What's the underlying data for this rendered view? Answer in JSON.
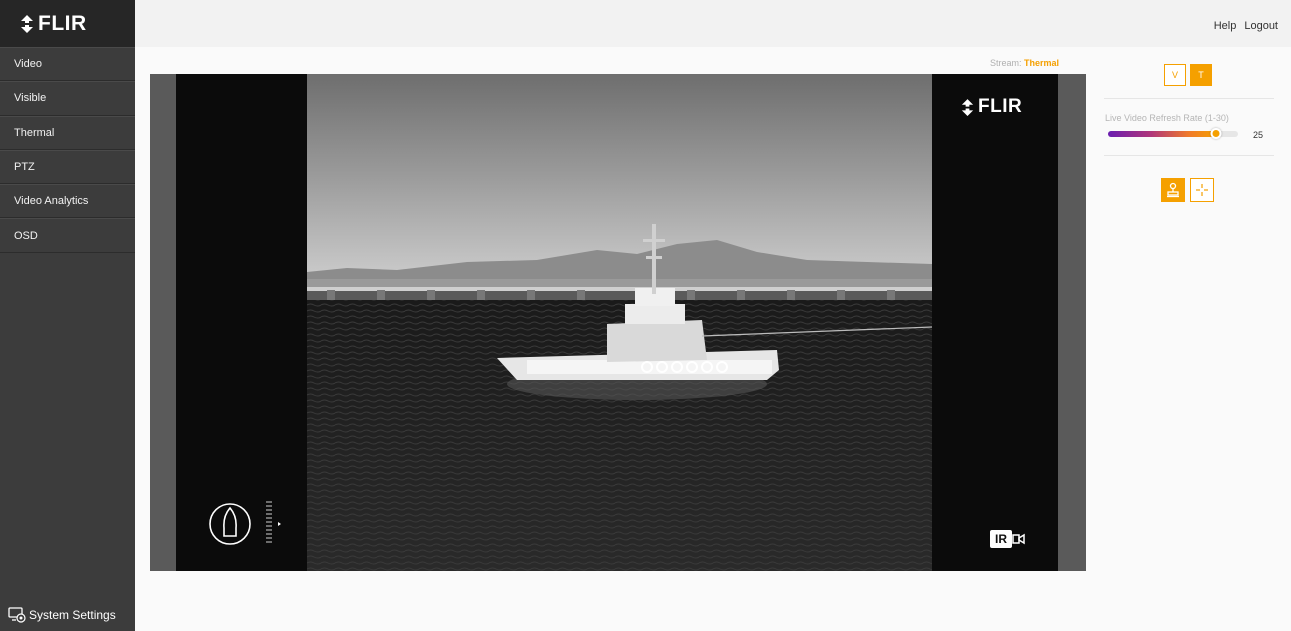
{
  "brand": {
    "logo_text": "FLIR"
  },
  "header": {
    "help_label": "Help",
    "logout_label": "Logout"
  },
  "sidebar": {
    "items": [
      {
        "label": "Video"
      },
      {
        "label": "Visible"
      },
      {
        "label": "Thermal"
      },
      {
        "label": "PTZ"
      },
      {
        "label": "Video Analytics"
      },
      {
        "label": "OSD"
      }
    ],
    "system_settings_label": "System Settings"
  },
  "stream": {
    "label": "Stream:",
    "value": "Thermal"
  },
  "video": {
    "overlay_logo_text": "FLIR",
    "ir_badge_text": "IR",
    "icons": [
      "compass-icon",
      "video-camera-icon"
    ]
  },
  "controls": {
    "mode_buttons": [
      {
        "label": "V",
        "active": false
      },
      {
        "label": "T",
        "active": true
      }
    ],
    "refresh_rate": {
      "label": "Live Video Refresh Rate (1-30)",
      "value": "25",
      "min": 1,
      "max": 30
    },
    "tools": [
      {
        "icon": "joystick-icon",
        "active": true
      },
      {
        "icon": "crosshair-icon",
        "active": false
      }
    ]
  },
  "colors": {
    "accent": "#f5a000",
    "sidebar_bg": "#3c3c3c",
    "logo_bg": "#262626"
  }
}
